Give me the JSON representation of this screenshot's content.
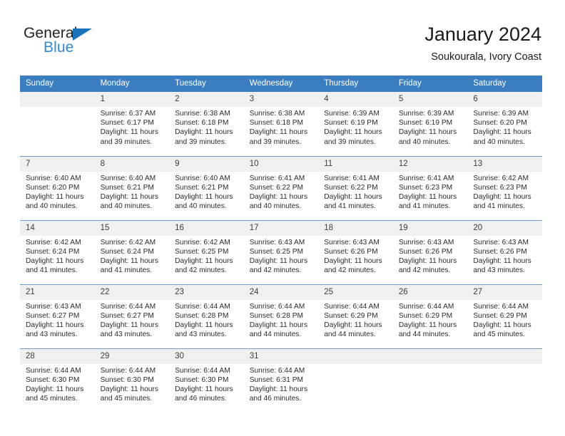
{
  "brand": {
    "name_dark": "General",
    "name_light": "Blue",
    "accent_color": "#2e8ad4",
    "triangle_color": "#1a72b8"
  },
  "header": {
    "title": "January 2024",
    "subtitle": "Soukourala, Ivory Coast"
  },
  "theme": {
    "header_blue": "#3b7ec0",
    "daynum_band": "#f0f0f0",
    "row_divider": "#6f9dc8",
    "text": "#2b2b2b"
  },
  "weekdays": [
    "Sunday",
    "Monday",
    "Tuesday",
    "Wednesday",
    "Thursday",
    "Friday",
    "Saturday"
  ],
  "weeks": [
    [
      {
        "day": "",
        "blank": true,
        "lines": []
      },
      {
        "day": "1",
        "lines": [
          "Sunrise: 6:37 AM",
          "Sunset: 6:17 PM",
          "Daylight: 11 hours",
          "and 39 minutes."
        ]
      },
      {
        "day": "2",
        "lines": [
          "Sunrise: 6:38 AM",
          "Sunset: 6:18 PM",
          "Daylight: 11 hours",
          "and 39 minutes."
        ]
      },
      {
        "day": "3",
        "lines": [
          "Sunrise: 6:38 AM",
          "Sunset: 6:18 PM",
          "Daylight: 11 hours",
          "and 39 minutes."
        ]
      },
      {
        "day": "4",
        "lines": [
          "Sunrise: 6:39 AM",
          "Sunset: 6:19 PM",
          "Daylight: 11 hours",
          "and 39 minutes."
        ]
      },
      {
        "day": "5",
        "lines": [
          "Sunrise: 6:39 AM",
          "Sunset: 6:19 PM",
          "Daylight: 11 hours",
          "and 40 minutes."
        ]
      },
      {
        "day": "6",
        "lines": [
          "Sunrise: 6:39 AM",
          "Sunset: 6:20 PM",
          "Daylight: 11 hours",
          "and 40 minutes."
        ]
      }
    ],
    [
      {
        "day": "7",
        "lines": [
          "Sunrise: 6:40 AM",
          "Sunset: 6:20 PM",
          "Daylight: 11 hours",
          "and 40 minutes."
        ]
      },
      {
        "day": "8",
        "lines": [
          "Sunrise: 6:40 AM",
          "Sunset: 6:21 PM",
          "Daylight: 11 hours",
          "and 40 minutes."
        ]
      },
      {
        "day": "9",
        "lines": [
          "Sunrise: 6:40 AM",
          "Sunset: 6:21 PM",
          "Daylight: 11 hours",
          "and 40 minutes."
        ]
      },
      {
        "day": "10",
        "lines": [
          "Sunrise: 6:41 AM",
          "Sunset: 6:22 PM",
          "Daylight: 11 hours",
          "and 40 minutes."
        ]
      },
      {
        "day": "11",
        "lines": [
          "Sunrise: 6:41 AM",
          "Sunset: 6:22 PM",
          "Daylight: 11 hours",
          "and 41 minutes."
        ]
      },
      {
        "day": "12",
        "lines": [
          "Sunrise: 6:41 AM",
          "Sunset: 6:23 PM",
          "Daylight: 11 hours",
          "and 41 minutes."
        ]
      },
      {
        "day": "13",
        "lines": [
          "Sunrise: 6:42 AM",
          "Sunset: 6:23 PM",
          "Daylight: 11 hours",
          "and 41 minutes."
        ]
      }
    ],
    [
      {
        "day": "14",
        "lines": [
          "Sunrise: 6:42 AM",
          "Sunset: 6:24 PM",
          "Daylight: 11 hours",
          "and 41 minutes."
        ]
      },
      {
        "day": "15",
        "lines": [
          "Sunrise: 6:42 AM",
          "Sunset: 6:24 PM",
          "Daylight: 11 hours",
          "and 41 minutes."
        ]
      },
      {
        "day": "16",
        "lines": [
          "Sunrise: 6:42 AM",
          "Sunset: 6:25 PM",
          "Daylight: 11 hours",
          "and 42 minutes."
        ]
      },
      {
        "day": "17",
        "lines": [
          "Sunrise: 6:43 AM",
          "Sunset: 6:25 PM",
          "Daylight: 11 hours",
          "and 42 minutes."
        ]
      },
      {
        "day": "18",
        "lines": [
          "Sunrise: 6:43 AM",
          "Sunset: 6:26 PM",
          "Daylight: 11 hours",
          "and 42 minutes."
        ]
      },
      {
        "day": "19",
        "lines": [
          "Sunrise: 6:43 AM",
          "Sunset: 6:26 PM",
          "Daylight: 11 hours",
          "and 42 minutes."
        ]
      },
      {
        "day": "20",
        "lines": [
          "Sunrise: 6:43 AM",
          "Sunset: 6:26 PM",
          "Daylight: 11 hours",
          "and 43 minutes."
        ]
      }
    ],
    [
      {
        "day": "21",
        "lines": [
          "Sunrise: 6:43 AM",
          "Sunset: 6:27 PM",
          "Daylight: 11 hours",
          "and 43 minutes."
        ]
      },
      {
        "day": "22",
        "lines": [
          "Sunrise: 6:44 AM",
          "Sunset: 6:27 PM",
          "Daylight: 11 hours",
          "and 43 minutes."
        ]
      },
      {
        "day": "23",
        "lines": [
          "Sunrise: 6:44 AM",
          "Sunset: 6:28 PM",
          "Daylight: 11 hours",
          "and 43 minutes."
        ]
      },
      {
        "day": "24",
        "lines": [
          "Sunrise: 6:44 AM",
          "Sunset: 6:28 PM",
          "Daylight: 11 hours",
          "and 44 minutes."
        ]
      },
      {
        "day": "25",
        "lines": [
          "Sunrise: 6:44 AM",
          "Sunset: 6:29 PM",
          "Daylight: 11 hours",
          "and 44 minutes."
        ]
      },
      {
        "day": "26",
        "lines": [
          "Sunrise: 6:44 AM",
          "Sunset: 6:29 PM",
          "Daylight: 11 hours",
          "and 44 minutes."
        ]
      },
      {
        "day": "27",
        "lines": [
          "Sunrise: 6:44 AM",
          "Sunset: 6:29 PM",
          "Daylight: 11 hours",
          "and 45 minutes."
        ]
      }
    ],
    [
      {
        "day": "28",
        "lines": [
          "Sunrise: 6:44 AM",
          "Sunset: 6:30 PM",
          "Daylight: 11 hours",
          "and 45 minutes."
        ]
      },
      {
        "day": "29",
        "lines": [
          "Sunrise: 6:44 AM",
          "Sunset: 6:30 PM",
          "Daylight: 11 hours",
          "and 45 minutes."
        ]
      },
      {
        "day": "30",
        "lines": [
          "Sunrise: 6:44 AM",
          "Sunset: 6:30 PM",
          "Daylight: 11 hours",
          "and 46 minutes."
        ]
      },
      {
        "day": "31",
        "lines": [
          "Sunrise: 6:44 AM",
          "Sunset: 6:31 PM",
          "Daylight: 11 hours",
          "and 46 minutes."
        ]
      },
      {
        "day": "",
        "blank": true,
        "lines": []
      },
      {
        "day": "",
        "blank": true,
        "lines": []
      },
      {
        "day": "",
        "blank": true,
        "lines": []
      }
    ]
  ]
}
